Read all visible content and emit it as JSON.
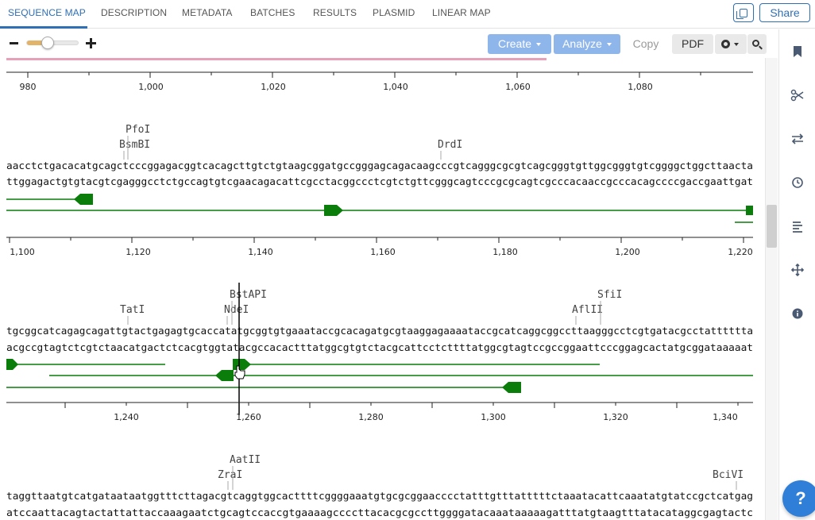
{
  "tabs": [
    {
      "label": "SEQUENCE MAP",
      "active": true
    },
    {
      "label": "DESCRIPTION"
    },
    {
      "label": "METADATA"
    },
    {
      "label": "BATCHES"
    },
    {
      "label": "RESULTS"
    },
    {
      "label": "PLASMID"
    },
    {
      "label": "LINEAR MAP"
    }
  ],
  "header": {
    "share_label": "Share",
    "copy_link_icon": "copy-link-icon"
  },
  "toolbar": {
    "zoom_out_icon": "minus-icon",
    "zoom_in_icon": "plus-icon",
    "zoom_level_fraction": 0.4,
    "create_label": "Create",
    "analyze_label": "Analyze",
    "copy_label": "Copy",
    "pdf_label": "PDF",
    "settings_icon": "gear-icon",
    "search_icon": "search-icon"
  },
  "colors": {
    "accent": "#2f6fb5",
    "feature": "#0a7d0a",
    "primer_bar": "#e6a0b8",
    "toolbar_button": "#8fb6ea",
    "zoom_fill": "#e2b46a"
  },
  "sequence": {
    "rows": [
      {
        "start_tick": 980,
        "ticks": [
          "980",
          "1,000",
          "1,020",
          "1,040",
          "1,060",
          "1,080"
        ],
        "enzymes": [],
        "top": "",
        "bottom": ""
      },
      {
        "ticks": [
          "1,100",
          "1,120",
          "1,140",
          "1,160",
          "1,180",
          "1,200",
          "1,220"
        ],
        "enzymes": [
          "PfoI",
          "BsmBI",
          "DrdI"
        ],
        "top": "aacctctgacacatgcagctcccggagacggtcacagcttgtctgtaagcggatgccgggagcagacaagcccgtcagggcgcgtcagcgggtgttggcgggtgtcggggctggcttaacta",
        "bottom": "ttggagactgtgtacgtcgagggcctctgccagtgtcgaacagacattcgcctacggccctcgtctgttcgggcagtcccgcgcagtcgcccacaaccgcccacagccccgaccgaattgat"
      },
      {
        "ticks": [
          "1,240",
          "1,260",
          "1,280",
          "1,300",
          "1,320",
          "1,340"
        ],
        "enzymes": [
          "BstAPI",
          "SfiI",
          "TatI",
          "NdeI",
          "AflII"
        ],
        "top": "tgcggcatcagagcagattgtactgagagtgcaccatatgcggtgtgaaataccgcacagatgcgtaaggagaaaataccgcatcaggcggccttaagggcctcgtgatacgcctatttttta",
        "bottom": "acgccgtagtctcgtctaacatgactctcacgtggtatacgccacactttatggcgtgtctacgcattcctcttttatggcgtagtccgccggaattcccggagcactatgcggataaaaat"
      },
      {
        "ticks": [],
        "enzymes": [
          "AatII",
          "ZraI",
          "BciVI"
        ],
        "top": "taggttaatgtcatgataataatggtttcttagacgtcaggtggcacttttcggggaaatgtgcgcggaacccctatttgtttatttttctaaatacattcaaatatgtatccgctcatgag",
        "bottom": "atccaattacagtactattattaccaaagaatctgcagtccaccgtgaaaagccccttacacgcgccttggggatacaaataaaaagatttatgtaagtttatacataggcgagtactc"
      }
    ]
  },
  "sidebar": {
    "icons": [
      "bookmark-icon",
      "scissors-icon",
      "swap-arrows-icon",
      "clock-icon",
      "align-left-icon",
      "move-icon",
      "info-icon"
    ]
  },
  "help": {
    "label": "?"
  }
}
